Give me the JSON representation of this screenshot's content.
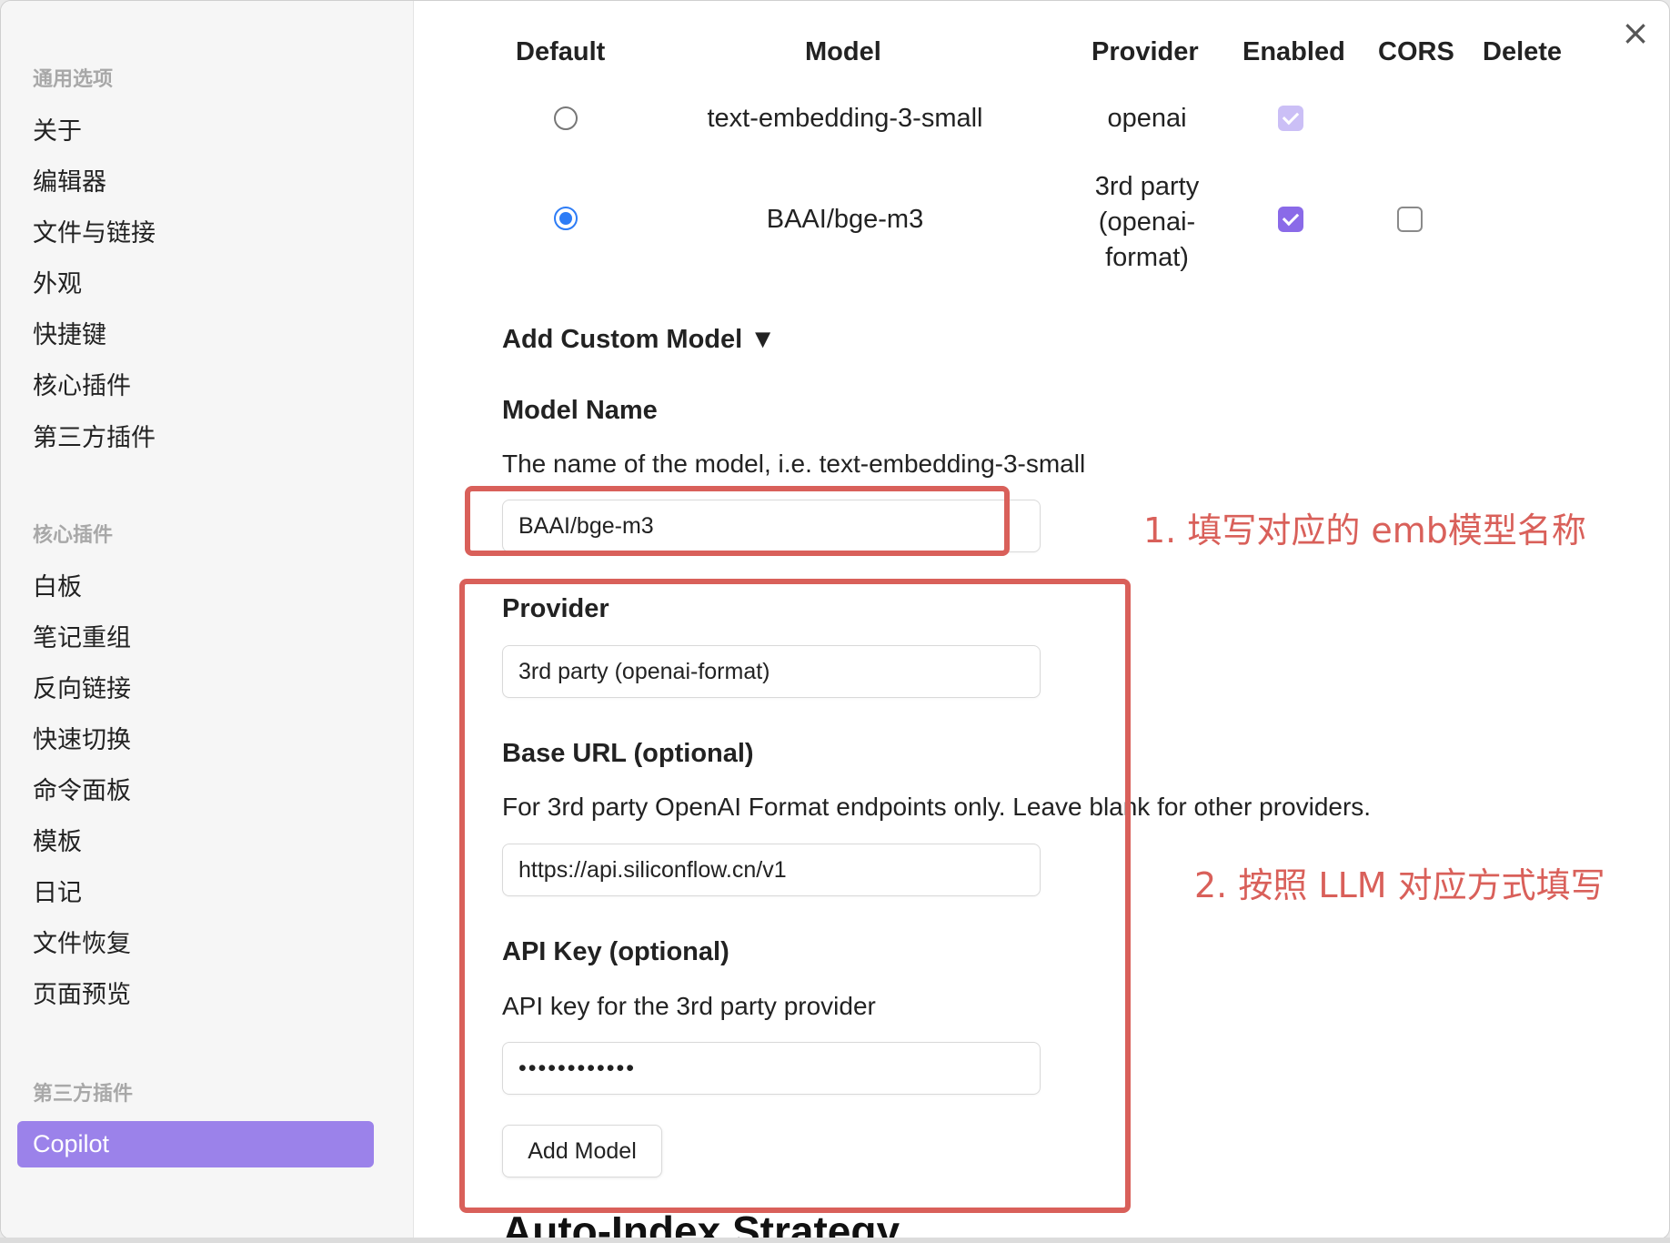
{
  "sidebar": {
    "groups": [
      {
        "title": "通用选项",
        "items": [
          "关于",
          "编辑器",
          "文件与链接",
          "外观",
          "快捷键",
          "核心插件",
          "第三方插件"
        ]
      },
      {
        "title": "核心插件",
        "items": [
          "白板",
          "笔记重组",
          "反向链接",
          "快速切换",
          "命令面板",
          "模板",
          "日记",
          "文件恢复",
          "页面预览"
        ]
      },
      {
        "title": "第三方插件",
        "items": [
          "Copilot"
        ]
      }
    ],
    "active_item": "Copilot",
    "accent_color": "#9b82ea"
  },
  "close_icon": "close-icon",
  "table": {
    "headers": {
      "default": "Default",
      "model": "Model",
      "provider": "Provider",
      "enabled": "Enabled",
      "cors": "CORS",
      "delete": "Delete"
    },
    "rows": [
      {
        "default": false,
        "model": "text-embedding-3-small",
        "provider": "openai",
        "enabled": true,
        "enabled_disabled": true,
        "cors": null
      },
      {
        "default": true,
        "model": "BAAI/bge-m3",
        "provider": "3rd party (openai-format)",
        "enabled": true,
        "enabled_disabled": false,
        "cors": false
      }
    ]
  },
  "form": {
    "add_custom_model": "Add Custom Model ▼",
    "model_name": {
      "label": "Model Name",
      "description": "The name of the model, i.e. text-embedding-3-small",
      "value": "BAAI/bge-m3"
    },
    "provider": {
      "label": "Provider",
      "value": "3rd party (openai-format)"
    },
    "base_url": {
      "label": "Base URL (optional)",
      "description": "For 3rd party OpenAI Format endpoints only. Leave blank for other providers.",
      "value": "https://api.siliconflow.cn/v1"
    },
    "api_key": {
      "label": "API Key (optional)",
      "description": "API key for the 3rd party provider",
      "value": "••••••••••••"
    },
    "add_model_button": "Add Model"
  },
  "next_section_heading": "Auto-Index Strategy",
  "annotations": {
    "note1": "1. 填写对应的 emb模型名称",
    "note2": "2. 按照 LLM 对应方式填写",
    "color": "#d9605a"
  }
}
